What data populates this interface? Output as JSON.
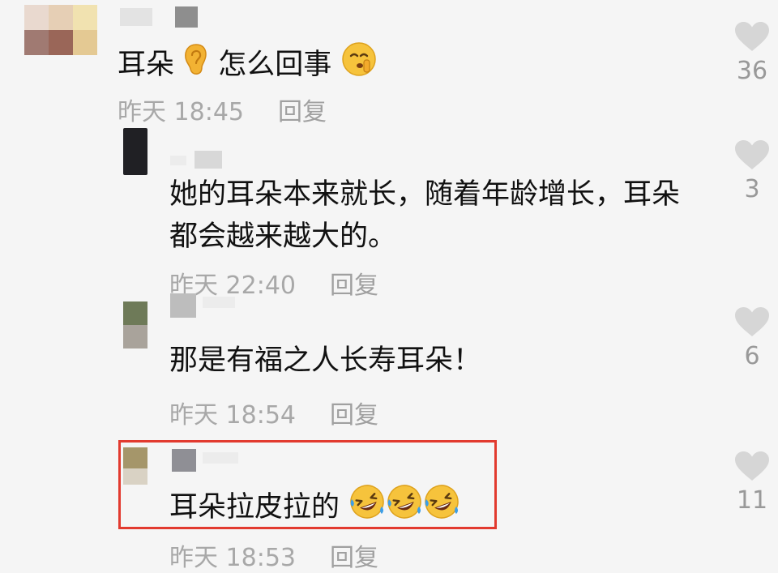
{
  "colors": {
    "background": "#f5f5f5",
    "text": "#111111",
    "meta_text": "#a8a8a8",
    "heart": "#d6d6d6",
    "highlight_border": "#e23a2f"
  },
  "comments": [
    {
      "text_parts": [
        "耳朵",
        "怎么回事"
      ],
      "emojis": [
        "ear-emoji",
        "shushing-face-emoji"
      ],
      "time": "昨天 18:45",
      "reply_label": "回复",
      "likes": "36"
    },
    {
      "text_lines": [
        "她的耳朵本来就长，随着年龄增长，耳朵",
        "都会越来越大的。"
      ],
      "time": "昨天 22:40",
      "reply_label": "回复",
      "likes": "3"
    },
    {
      "text": "那是有福之人长寿耳朵！",
      "time": "昨天 18:54",
      "reply_label": "回复",
      "likes": "6"
    },
    {
      "text": "耳朵拉皮拉的",
      "emojis": [
        "rolling-laughing-emoji",
        "rolling-laughing-emoji",
        "rolling-laughing-emoji"
      ],
      "time": "昨天 18:53",
      "reply_label": "回复",
      "likes": "11",
      "highlighted": true
    }
  ]
}
